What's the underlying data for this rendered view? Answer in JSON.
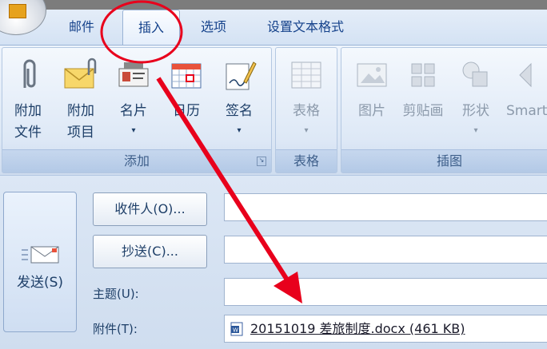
{
  "tabs": [
    {
      "label": "邮件",
      "active": false
    },
    {
      "label": "插入",
      "active": true
    },
    {
      "label": "选项",
      "active": false
    },
    {
      "label": "设置文本格式",
      "active": false
    }
  ],
  "ribbon": {
    "groups": {
      "add": {
        "label": "添加",
        "buttons": [
          {
            "label": "附加\n文件",
            "icon": "paperclip-icon"
          },
          {
            "label": "附加\n项目",
            "icon": "envelope-attach-icon"
          },
          {
            "label": "名片",
            "icon": "business-card-icon",
            "dropdown": true
          },
          {
            "label": "日历",
            "icon": "calendar-icon"
          },
          {
            "label": "签名",
            "icon": "signature-icon",
            "dropdown": true
          }
        ]
      },
      "table": {
        "label": "表格",
        "buttons": [
          {
            "label": "表格",
            "icon": "table-icon",
            "dropdown": true
          }
        ]
      },
      "illustrations": {
        "label": "插图",
        "buttons": [
          {
            "label": "图片",
            "icon": "picture-icon"
          },
          {
            "label": "剪贴画",
            "icon": "clipart-icon"
          },
          {
            "label": "形状",
            "icon": "shapes-icon",
            "dropdown": true
          },
          {
            "label": "Smart",
            "icon": "smartart-icon"
          }
        ]
      }
    },
    "dropdown_glyph": "▾",
    "launcher_glyph": "↘"
  },
  "compose": {
    "send_label": "发送(S)",
    "to_label": "收件人(O)...",
    "cc_label": "抄送(C)...",
    "subject_label": "主题(U):",
    "attachment_label": "附件(T):",
    "attachment_file": "20151019 差旅制度.docx (461 KB)"
  },
  "colors": {
    "annotation": "#e8001c",
    "ribbon_text": "#1e3f68",
    "tab_text": "#15428b"
  }
}
